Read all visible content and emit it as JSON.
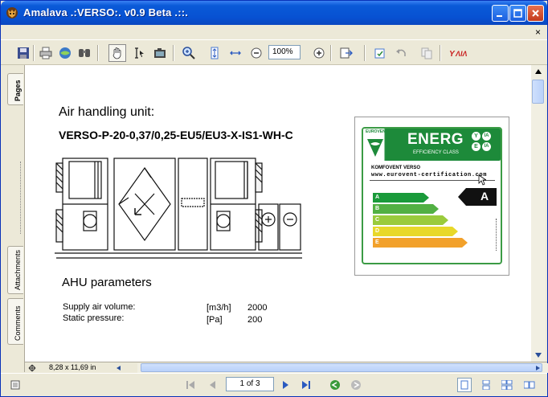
{
  "window": {
    "title": "Amalava .:VERSO:. v0.9 Beta .::.",
    "doc_close": "×"
  },
  "toolbar": {
    "zoom_value": "100%",
    "icons": [
      "save-icon",
      "print-icon",
      "email-icon",
      "search-icon",
      "hand-icon",
      "select-text-icon",
      "snapshot-icon",
      "zoom-in-icon",
      "fit-page-icon",
      "fit-width-icon",
      "zoom-out-icon",
      "zoom-in-small-icon",
      "export-icon",
      "rotate-icon",
      "undo-icon",
      "copy-icon",
      "app-logo-icon"
    ]
  },
  "sidebar": {
    "tabs": [
      "Pages",
      "Attachments",
      "Comments"
    ]
  },
  "document": {
    "heading": "Air handling unit:",
    "model": "VERSO-P-20-0,37/0,25-EU5/EU3-X-IS1-WH-C",
    "params_heading": "AHU parameters",
    "params": [
      {
        "name": "Supply air volume:",
        "unit": "[m3/h]",
        "value": "2000"
      },
      {
        "name": "Static pressure:",
        "unit": "[Pa]",
        "value": "200"
      }
    ],
    "label": {
      "brand": "EUROVENT",
      "energy_word": "ENERG",
      "class_text": "EFFICIENCY CLASS",
      "product": "KOMFOVENT VERSO",
      "url": "www.eurovent-certification.com",
      "classes": [
        {
          "letter": "A",
          "color": "#1a9a3a"
        },
        {
          "letter": "B",
          "color": "#52b043"
        },
        {
          "letter": "C",
          "color": "#9acb3c"
        },
        {
          "letter": "D",
          "color": "#e8d82a"
        },
        {
          "letter": "E",
          "color": "#f2a12b"
        }
      ],
      "rating": "A",
      "energy_tag_a": "Y",
      "energy_tag_b": "IA",
      "energy_tag_c": "E",
      "energy_tag_d": "IA"
    }
  },
  "status": {
    "page_size": "8,28 x 11,69 in",
    "page_indicator": "1 of 3"
  }
}
